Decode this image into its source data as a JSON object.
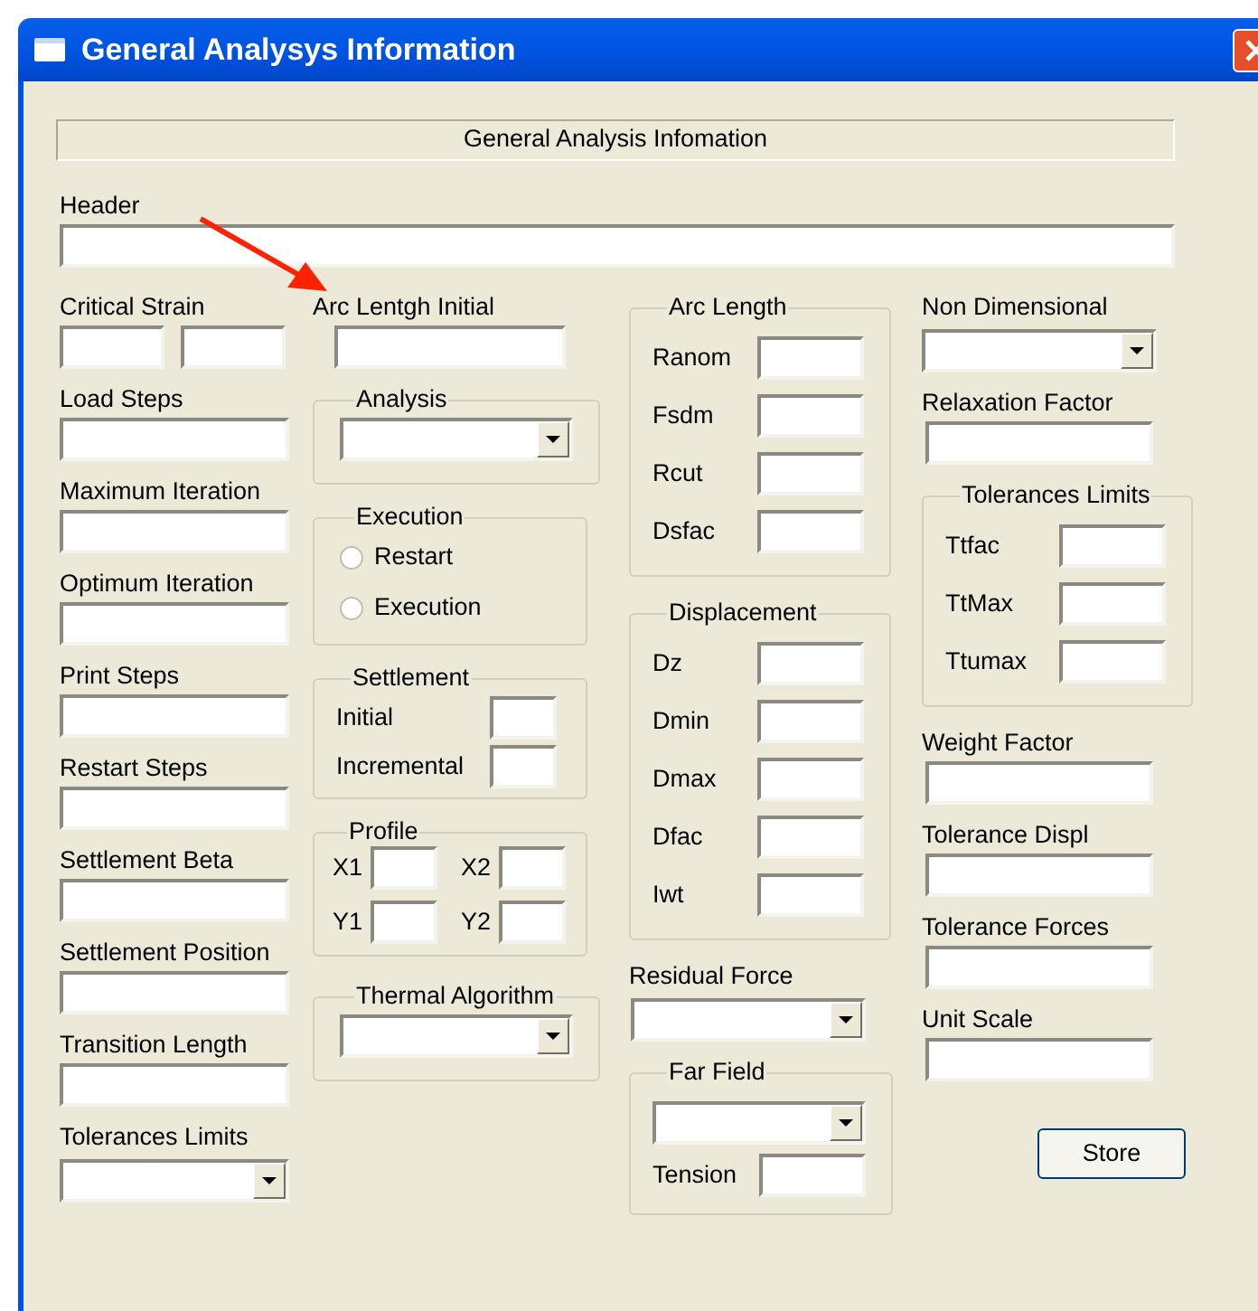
{
  "window": {
    "title": "General Analysys Information"
  },
  "banner": "General Analysis Infomation",
  "header": {
    "label": "Header"
  },
  "column_1": [
    {
      "kind": "pair",
      "label": "Critical Strain"
    },
    {
      "kind": "field",
      "label": "Load Steps"
    },
    {
      "kind": "field",
      "label": "Maximum Iteration"
    },
    {
      "kind": "field",
      "label": "Optimum Iteration"
    },
    {
      "kind": "field",
      "label": "Print Steps"
    },
    {
      "kind": "field",
      "label": "Restart Steps"
    },
    {
      "kind": "field",
      "label": "Settlement Beta"
    },
    {
      "kind": "field",
      "label": "Settlement Position"
    },
    {
      "kind": "field",
      "label": "Transition Length"
    },
    {
      "kind": "combo",
      "label": "Tolerances Limits"
    }
  ],
  "column_2": [
    {
      "kind": "field",
      "label": "Arc Lentgh Initial"
    },
    {
      "kind": "combo_group",
      "title": "Analysis"
    },
    {
      "kind": "radio_group",
      "title": "Execution",
      "options": [
        {
          "label": "Restart",
          "selected": false
        },
        {
          "label": "Execution",
          "selected": false
        }
      ]
    },
    {
      "kind": "compact_group",
      "title": "Settlement",
      "fields": [
        "Initial",
        "Incremental"
      ]
    },
    {
      "kind": "pair_group",
      "title": "Profile",
      "fields": [
        "X1",
        "X2",
        "Y1",
        "Y2"
      ]
    },
    {
      "kind": "combo_group",
      "title": "Thermal Algorithm"
    }
  ],
  "column_3": [
    {
      "kind": "grid_group",
      "title": "Arc Length",
      "fields": [
        "Ranom",
        "Fsdm",
        "Rcut",
        "Dsfac"
      ]
    },
    {
      "kind": "grid_group",
      "title": "Displacement",
      "fields": [
        "Dz",
        "Dmin",
        "Dmax",
        "Dfac",
        "Iwt"
      ]
    },
    {
      "kind": "combo",
      "label": "Residual Force"
    },
    {
      "kind": "combo_field_group",
      "title": "Far Field",
      "fields": [
        "Tension"
      ]
    }
  ],
  "column_4": [
    {
      "kind": "combo",
      "label": "Non Dimensional"
    },
    {
      "kind": "field",
      "label": "Relaxation Factor"
    },
    {
      "kind": "grid_group",
      "title": "Tolerances Limits",
      "fields": [
        "Ttfac",
        "TtMax",
        "Ttumax"
      ]
    },
    {
      "kind": "field",
      "label": "Weight Factor"
    },
    {
      "kind": "field",
      "label": "Tolerance Displ"
    },
    {
      "kind": "field",
      "label": "Tolerance Forces"
    },
    {
      "kind": "field",
      "label": "Unit Scale"
    },
    {
      "kind": "button",
      "label": "Store"
    }
  ]
}
